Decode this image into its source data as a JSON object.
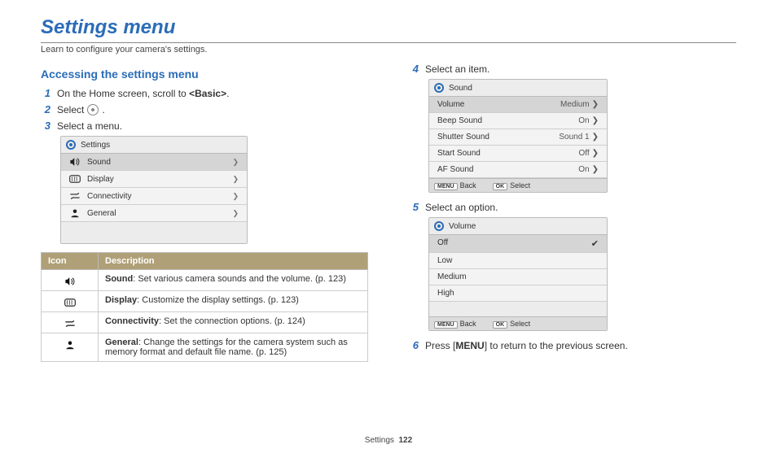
{
  "page": {
    "title": "Settings menu",
    "subtitle": "Learn to configure your camera's settings.",
    "footer_section": "Settings",
    "footer_page": "122"
  },
  "left": {
    "section_title": "Accessing the settings menu",
    "steps": {
      "s1_num": "1",
      "s1_text_a": "On the Home screen, scroll to ",
      "s1_text_b": "<Basic>",
      "s1_text_c": ".",
      "s2_num": "2",
      "s2_text_a": "Select ",
      "s2_text_b": ".",
      "s3_num": "3",
      "s3_text": "Select a menu."
    },
    "panel": {
      "title": "Settings",
      "rows": [
        {
          "icon": "speaker",
          "label": "Sound"
        },
        {
          "icon": "display",
          "label": "Display"
        },
        {
          "icon": "connectivity",
          "label": "Connectivity"
        },
        {
          "icon": "person",
          "label": "General"
        }
      ]
    },
    "table": {
      "header_icon": "Icon",
      "header_desc": "Description",
      "rows": [
        {
          "icon": "speaker",
          "bold": "Sound",
          "text": ": Set various camera sounds and the volume. (p. 123)"
        },
        {
          "icon": "display",
          "bold": "Display",
          "text": ": Customize the display settings. (p. 123)"
        },
        {
          "icon": "connectivity",
          "bold": "Connectivity",
          "text": ": Set the connection options. (p. 124)"
        },
        {
          "icon": "person",
          "bold": "General",
          "text": ": Change the settings for the camera system such as memory format and default file name. (p. 125)"
        }
      ]
    }
  },
  "right": {
    "steps": {
      "s4_num": "4",
      "s4_text": "Select an item.",
      "s5_num": "5",
      "s5_text": "Select an option.",
      "s6_num": "6",
      "s6_text_a": "Press [",
      "s6_menu": "MENU",
      "s6_text_b": "] to return to the previous screen."
    },
    "sound_panel": {
      "title": "Sound",
      "rows": [
        {
          "label": "Volume",
          "value": "Medium"
        },
        {
          "label": "Beep Sound",
          "value": "On"
        },
        {
          "label": "Shutter Sound",
          "value": "Sound 1"
        },
        {
          "label": "Start Sound",
          "value": "Off"
        },
        {
          "label": "AF Sound",
          "value": "On"
        }
      ],
      "footer_back_key": "MENU",
      "footer_back": "Back",
      "footer_select_key": "OK",
      "footer_select": "Select"
    },
    "volume_panel": {
      "title": "Volume",
      "rows": [
        {
          "label": "Off",
          "selected": true
        },
        {
          "label": "Low"
        },
        {
          "label": "Medium"
        },
        {
          "label": "High"
        }
      ],
      "footer_back_key": "MENU",
      "footer_back": "Back",
      "footer_select_key": "OK",
      "footer_select": "Select"
    }
  }
}
